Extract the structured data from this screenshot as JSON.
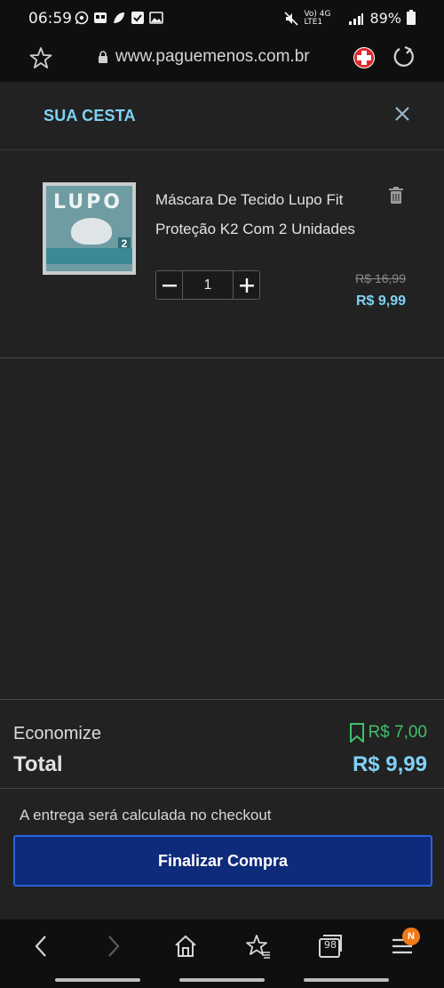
{
  "status_bar": {
    "time": "06:59",
    "network": "Vo) 4G LTE1",
    "battery": "89%"
  },
  "browser": {
    "url": "www.paguemenos.com.br"
  },
  "cart": {
    "title": "SUA CESTA",
    "item": {
      "name": "Máscara De Tecido Lupo Fit Proteção K2 Com 2 Unidades",
      "thumb_brand": "LUPO",
      "thumb_count": "2",
      "quantity": "1",
      "old_price": "R$ 16,99",
      "price": "R$ 9,99"
    }
  },
  "summary": {
    "economize_label": "Economize",
    "economize_value": "R$ 7,00",
    "total_label": "Total",
    "total_value": "R$ 9,99",
    "delivery_note": "A entrega será calculada no checkout",
    "finalize_label": "Finalizar Compra"
  },
  "nav": {
    "tabs_count": "98",
    "menu_badge": "N"
  },
  "colors": {
    "accent": "#7fd2f5",
    "savings": "#3ec06a",
    "button": "#0e2a7a"
  }
}
